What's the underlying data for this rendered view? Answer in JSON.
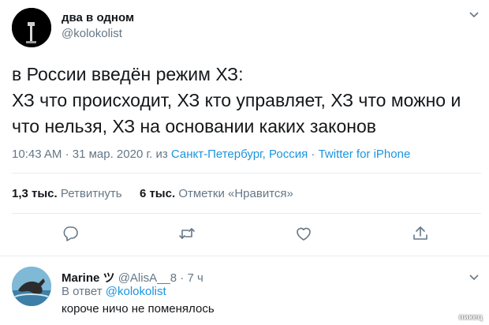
{
  "tweet": {
    "author_name": "два в одном",
    "author_handle": "@kolokolist",
    "text_lines": [
      "в России введён режим ХЗ:",
      "ХЗ что происходит, ХЗ кто управляет, ХЗ что можно и",
      "что нельзя, ХЗ на основании каких законов"
    ],
    "time": "10:43 AM",
    "date": "31 мар. 2020 г.",
    "from_word": "из",
    "location": "Санкт-Петербург, Россия",
    "source": "Twitter for iPhone",
    "retweets_count": "1,3 тыс.",
    "retweets_label": "Ретвитнуть",
    "likes_count": "6 тыс.",
    "likes_label": "Отметки «Нравится»"
  },
  "actions": [
    "reply-icon",
    "retweet-icon",
    "like-icon",
    "share-icon"
  ],
  "reply": {
    "name": "Marine ツ",
    "handle": "@AlisA__8",
    "separator": "·",
    "age": "7 ч",
    "reply_to_prefix": "В ответ",
    "reply_to_handle": "@kolokolist",
    "text": "короче ничо не поменялось"
  },
  "watermark": "пикец",
  "colors": {
    "link": "#1b95e0",
    "secondary": "#657786",
    "text": "#14171a",
    "divider": "#e6ecf0"
  }
}
